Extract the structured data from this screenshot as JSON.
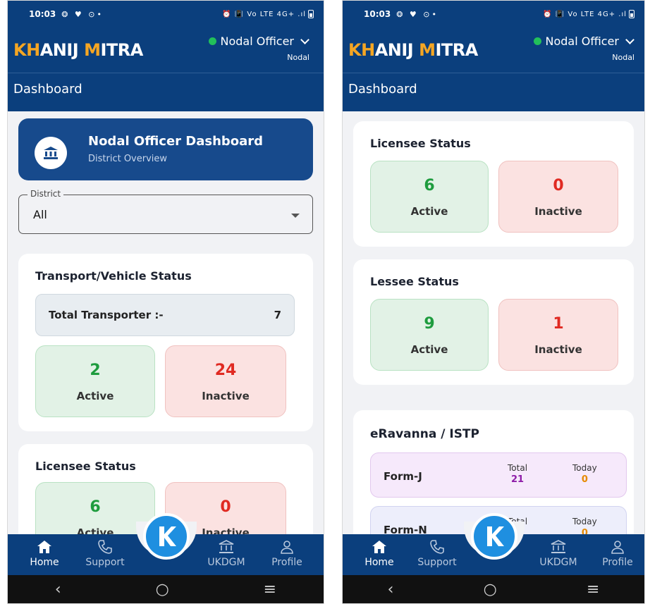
{
  "status_bar": {
    "time": "10:03",
    "left_glyphs": "❂ ♥ ⊙•",
    "right_icons": "⏰ 📳 Vo LTE 4G+ .ıl"
  },
  "header": {
    "brand_part1": "KH",
    "brand_part2": "ANIJ",
    "brand_part3": "M",
    "brand_part4": "ITRA",
    "user_name": "Nodal Officer",
    "user_role": "Nodal",
    "online_color": "#22c05a"
  },
  "page_title": "Dashboard",
  "screen1": {
    "hero": {
      "title": "Nodal Officer Dashboard",
      "subtitle": "District Overview",
      "icon": "bank-icon"
    },
    "district": {
      "label": "District",
      "value": "All"
    },
    "transport": {
      "title": "Transport/Vehicle Status",
      "total_label": "Total Transporter :-",
      "total_value": "7",
      "active_value": "2",
      "active_label": "Active",
      "inactive_value": "24",
      "inactive_label": "Inactive"
    },
    "licensee": {
      "title": "Licensee Status",
      "active_value": "6",
      "active_label": "Active",
      "inactive_value": "0",
      "inactive_label": "Inactive"
    }
  },
  "screen2": {
    "licensee": {
      "title": "Licensee Status",
      "active_value": "6",
      "active_label": "Active",
      "inactive_value": "0",
      "inactive_label": "Inactive"
    },
    "lessee": {
      "title": "Lessee Status",
      "active_value": "9",
      "active_label": "Active",
      "inactive_value": "1",
      "inactive_label": "Inactive"
    },
    "eravanna": {
      "title": "eRavanna / ISTP",
      "forms": [
        {
          "name": "Form-J",
          "total_label": "Total",
          "total_value": "21",
          "today_label": "Today",
          "today_value": "0"
        },
        {
          "name": "Form-N",
          "total_label": "Total",
          "total_value": "",
          "today_label": "Today",
          "today_value": "0"
        }
      ]
    }
  },
  "bottom_nav": {
    "items": [
      {
        "label": "Home",
        "icon": "home-icon"
      },
      {
        "label": "Support",
        "icon": "phone-icon"
      },
      {
        "label": "UKDGM",
        "icon": "bank-icon"
      },
      {
        "label": "Profile",
        "icon": "user-icon"
      }
    ],
    "fab_icon": "k-logo-icon"
  },
  "colors": {
    "primary": "#0b3f7d",
    "hero": "#174a8c",
    "active_green": "#1e9c3e",
    "inactive_red": "#e02a22",
    "fab_blue": "#1f8fe0",
    "brand_orange": "#f5a623"
  }
}
